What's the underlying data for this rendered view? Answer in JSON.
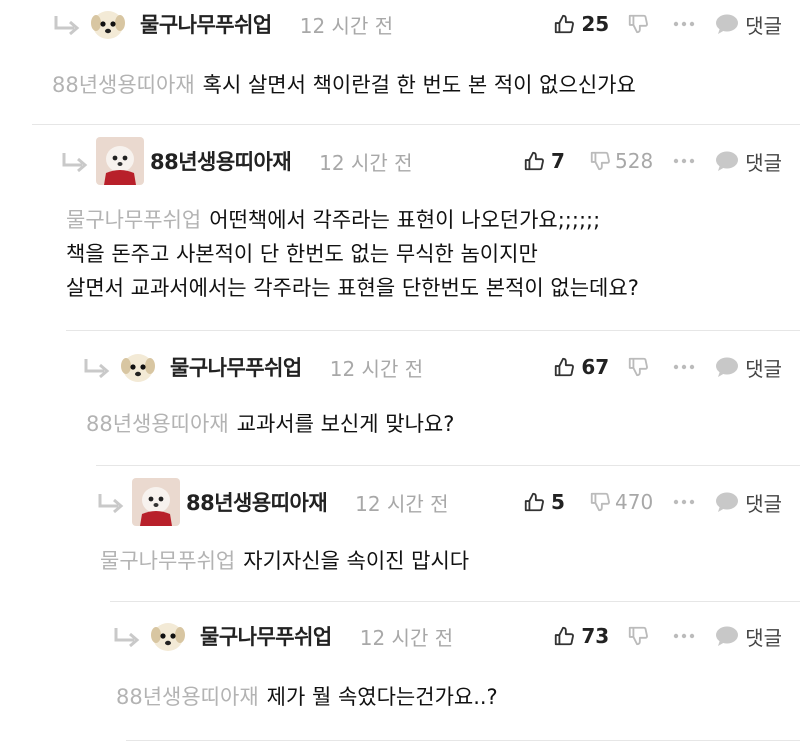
{
  "comments": [
    {
      "nickname": "물구나무푸쉬업",
      "avatar": "puppy-avatar",
      "time": "12 시간 전",
      "upvotes": "25",
      "downvotes": "",
      "reply_label": "댓글",
      "mention": "88년생용띠아재",
      "lines": [
        "혹시 살면서 책이란걸 한 번도 본 적이 없으신가요"
      ]
    },
    {
      "nickname": "88년생용띠아재",
      "avatar": "dog-red-scarf-avatar",
      "time": "12 시간 전",
      "upvotes": "7",
      "downvotes": "528",
      "reply_label": "댓글",
      "mention": "물구나무푸쉬업",
      "lines": [
        "어떤책에서 각주라는 표현이 나오던가요;;;;;;",
        "책을 돈주고 사본적이 단 한번도 없는 무식한 놈이지만",
        "살면서 교과서에서는 각주라는 표현을 단한번도 본적이 없는데요?"
      ]
    },
    {
      "nickname": "물구나무푸쉬업",
      "avatar": "puppy-avatar",
      "time": "12 시간 전",
      "upvotes": "67",
      "downvotes": "",
      "reply_label": "댓글",
      "mention": "88년생용띠아재",
      "lines": [
        "교과서를 보신게 맞나요?"
      ]
    },
    {
      "nickname": "88년생용띠아재",
      "avatar": "dog-red-scarf-avatar",
      "time": "12 시간 전",
      "upvotes": "5",
      "downvotes": "470",
      "reply_label": "댓글",
      "mention": "물구나무푸쉬업",
      "lines": [
        "자기자신을 속이진 맙시다"
      ]
    },
    {
      "nickname": "물구나무푸쉬업",
      "avatar": "puppy-avatar",
      "time": "12 시간 전",
      "upvotes": "73",
      "downvotes": "",
      "reply_label": "댓글",
      "mention": "88년생용띠아재",
      "lines": [
        "제가 뭘 속였다는건가요..?"
      ]
    }
  ]
}
